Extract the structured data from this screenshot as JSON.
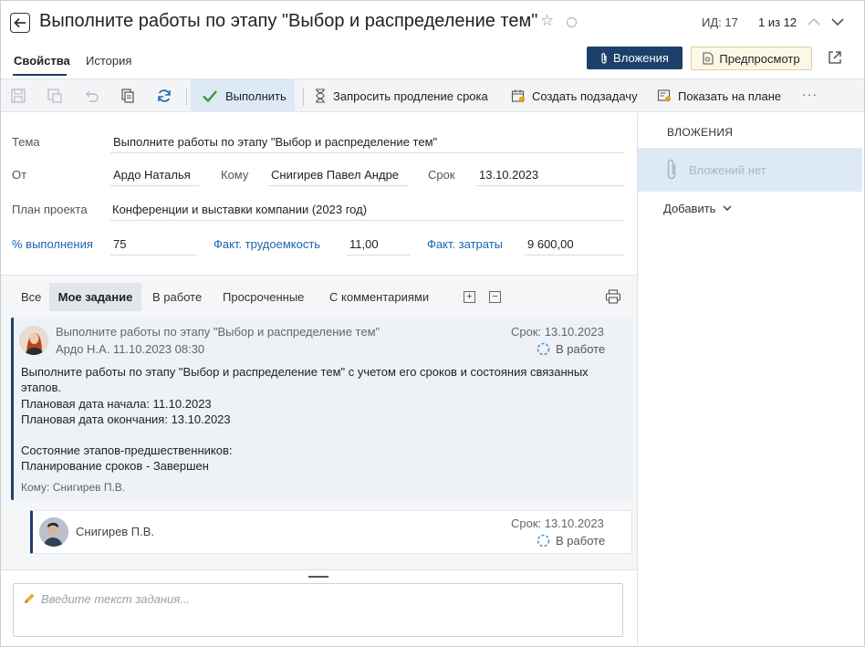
{
  "header": {
    "title": "Выполните работы по этапу \"Выбор и распределение тем\"",
    "id_label": "ИД: 17",
    "pager": "1 из 12"
  },
  "tabs": [
    {
      "label": "Свойства",
      "active": true
    },
    {
      "label": "История",
      "active": false
    }
  ],
  "actions": {
    "attachments": "Вложения",
    "preview": "Предпросмотр"
  },
  "toolbar": {
    "execute": "Выполнить",
    "request_extension": "Запросить продление срока",
    "create_subtask": "Создать подзадачу",
    "show_on_plan": "Показать на плане",
    "more": "···"
  },
  "properties": {
    "topic_label": "Тема",
    "topic": "Выполните работы по этапу \"Выбор и распределение тем\"",
    "from_label": "От",
    "from": "Ардо Наталья",
    "to_label": "Кому",
    "to": "Снигирев Павел Андре",
    "deadline_label": "Срок",
    "deadline": "13.10.2023",
    "project_label": "План проекта",
    "project": "Конференции и выставки компании (2023 год)",
    "percent_label": "% выполнения",
    "percent": "75",
    "labor_label": "Факт. трудоемкость",
    "labor": "11,00",
    "cost_label": "Факт. затраты",
    "cost": "9 600,00"
  },
  "attachments_panel": {
    "title": "ВЛОЖЕНИЯ",
    "empty": "Вложений нет",
    "add": "Добавить"
  },
  "filters": {
    "all": "Все",
    "my_task": "Мое задание",
    "in_work": "В работе",
    "overdue": "Просроченные",
    "with_comments": "С комментариями",
    "expand": "+",
    "collapse": "−"
  },
  "task_card": {
    "subject": "Выполните работы по этапу \"Выбор и распределение тем\"",
    "author_date": "Ардо Н.А.  11.10.2023 08:30",
    "due": "Срок: 13.10.2023",
    "status": "В работе",
    "body": [
      "Выполните работы по этапу \"Выбор и распределение тем\" с учетом его сроков и состояния связанных этапов.",
      "Плановая дата начала: 11.10.2023",
      "Плановая дата окончания: 13.10.2023",
      "",
      "Состояние этапов-предшественников:",
      "Планирование сроков - Завершен"
    ],
    "to": "Кому: Снигирев П.В."
  },
  "sub_card": {
    "name": "Снигирев П.В.",
    "due": "Срок: 13.10.2023",
    "status": "В работе"
  },
  "editor": {
    "placeholder": "Введите текст задания..."
  },
  "colors": {
    "accent": "#1d3f6b",
    "link": "#1d64a8",
    "highlight": "#dde9f5"
  }
}
